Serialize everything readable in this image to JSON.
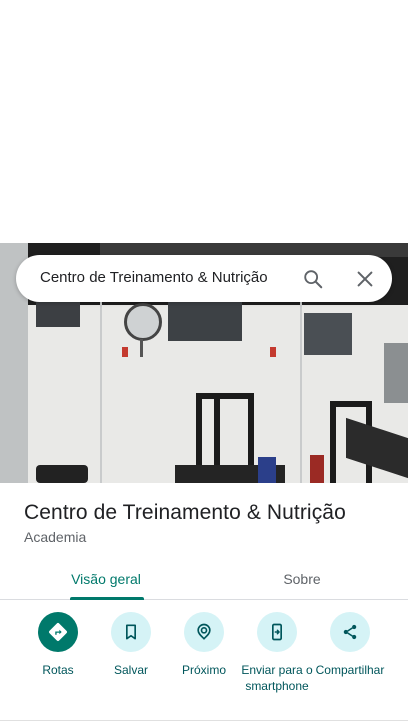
{
  "search": {
    "query": "Centro de Treinamento & Nutrição"
  },
  "place": {
    "title": "Centro de Treinamento & Nutrição",
    "category": "Academia"
  },
  "tabs": [
    {
      "label": "Visão geral",
      "active": true
    },
    {
      "label": "Sobre",
      "active": false
    }
  ],
  "actions": [
    {
      "label": "Rotas",
      "icon": "directions-icon"
    },
    {
      "label": "Salvar",
      "icon": "bookmark-icon"
    },
    {
      "label": "Próximo",
      "icon": "nearby-icon"
    },
    {
      "label": "Enviar para o smartphone",
      "icon": "send-to-phone-icon"
    },
    {
      "label": "Compartilhar",
      "icon": "share-icon"
    }
  ],
  "colors": {
    "accent": "#00796b",
    "action_bg": "#d5f3f6",
    "action_text": "#00565b"
  }
}
